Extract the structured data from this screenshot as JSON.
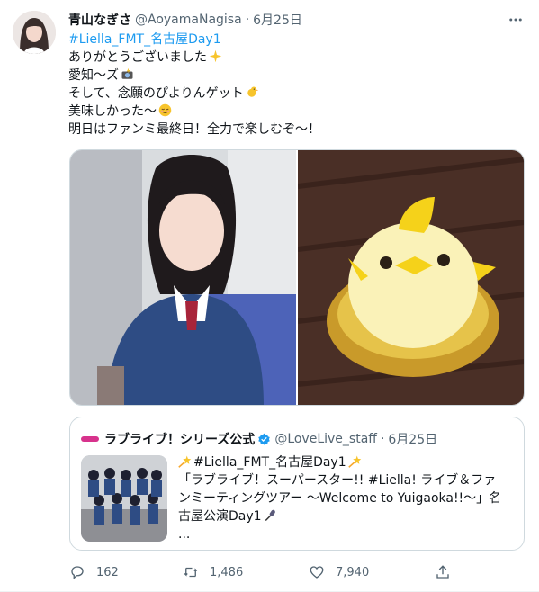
{
  "tweet": {
    "display_name": "青山なぎさ",
    "handle": "@AoyamaNagisa",
    "separator": "·",
    "date": "6月25日",
    "text_lines": [
      "#Liella_FMT_名古屋Day1",
      "ありがとうございました",
      "愛知〜ズ",
      "そして、念願のぴよりんゲット",
      "美味しかった〜",
      "明日はファンミ最終日！全力で楽しむぞ〜！"
    ],
    "emojis": [
      "sparkles-emoji",
      "camera-flash-emoji",
      "chick-emoji",
      "relieved-face-emoji"
    ]
  },
  "quote": {
    "display_name": "ラブライブ！シリーズ公式",
    "handle": "@LoveLive_staff",
    "separator": "·",
    "date": "6月25日",
    "text_lines": [
      "#Liella_FMT_名古屋Day1",
      "「ラブライブ！スーパースター!! #Liella! ライブ＆ファ",
      "ンミーティングツアー 〜Welcome to Yuigaoka!!〜」名",
      "古屋公演Day1",
      "..."
    ]
  },
  "actions": {
    "reply_count": "162",
    "retweet_count": "1,486",
    "like_count": "7,940"
  },
  "colors": {
    "link": "#1d9bf0",
    "text": "#0f1419",
    "secondary": "#536471",
    "border": "#cfd9de",
    "verified": "#1d9bf0",
    "brand_logo": "#d7328c"
  }
}
